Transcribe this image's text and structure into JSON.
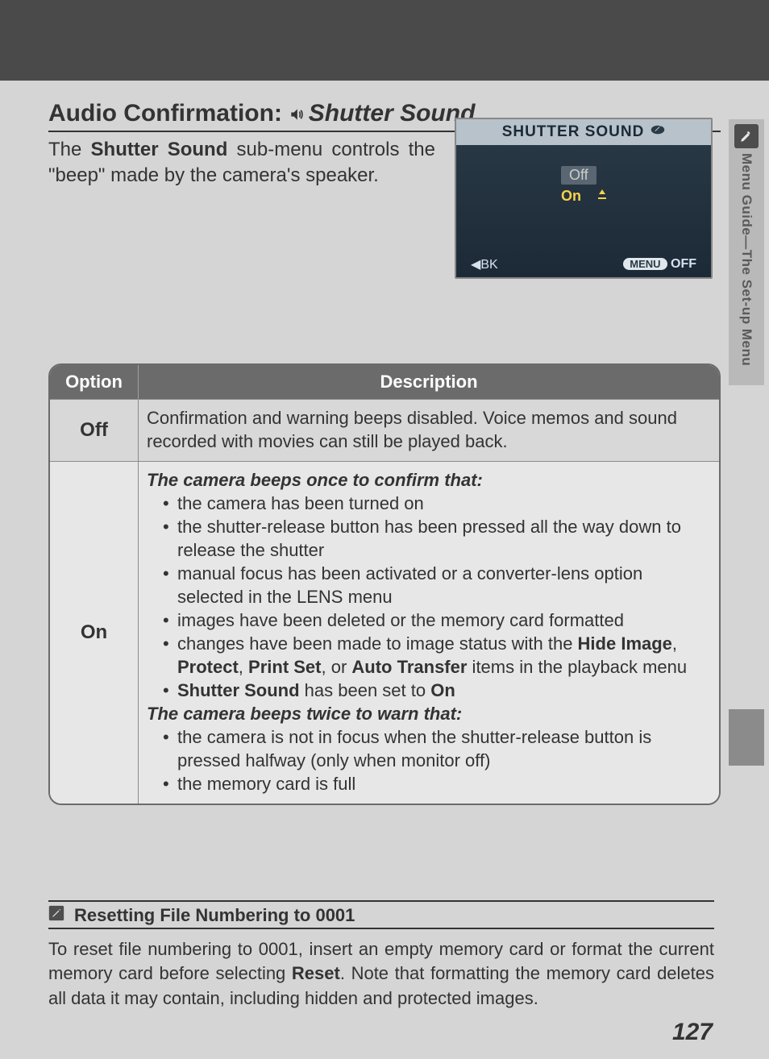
{
  "header": {
    "title_prefix": "Audio Confirmation: ",
    "title_main": "Shutter Sound"
  },
  "intro": {
    "text_pre": "The ",
    "bold": "Shutter Sound",
    "text_post": " sub-menu controls the \"beep\" made by the camera's speaker."
  },
  "lcd": {
    "title": "SHUTTER SOUND",
    "off": "Off",
    "on": "On",
    "bk": "BK",
    "menu": "MENU",
    "off_label": "OFF"
  },
  "table": {
    "head_option": "Option",
    "head_desc": "Description",
    "rows": {
      "off": {
        "label": "Off",
        "desc": "Confirmation and warning beeps disabled.  Voice memos and sound recorded with movies can still be played back."
      },
      "on": {
        "label": "On",
        "h1": "The camera beeps once to confirm that:",
        "b1": "the camera has been turned on",
        "b2": "the shutter-release button has been pressed all the way down to release the shutter",
        "b3": "manual focus has been activated or a converter-lens option selected in the LENS menu",
        "b4": "images have been deleted or the memory card formatted",
        "b5_pre": "changes have been made to image status with the ",
        "b5_hide": "Hide Image",
        "b5_c1": ", ",
        "b5_protect": "Protect",
        "b5_c2": ", ",
        "b5_print": "Print Set",
        "b5_c3": ", or ",
        "b5_auto": "Auto Transfer",
        "b5_post": " items in the playback menu",
        "b6_pre": "",
        "b6_bold1": "Shutter Sound",
        "b6_mid": " has been set to ",
        "b6_bold2": "On",
        "h2": "The camera beeps twice to warn that:",
        "b7": "the camera is not in focus when the shutter-release button is pressed halfway (only when monitor off)",
        "b8": "the memory card is full"
      }
    }
  },
  "note": {
    "heading": "Resetting File Numbering to 0001",
    "body_pre": "To reset file numbering to 0001, insert an empty memory card or format the current memory card before selecting ",
    "body_bold": "Reset",
    "body_post": ".  Note that formatting the memory card deletes all data it may contain, including hidden and protected images."
  },
  "sidebar": {
    "text": "Menu Guide—The Set-up Menu"
  },
  "page_number": "127"
}
